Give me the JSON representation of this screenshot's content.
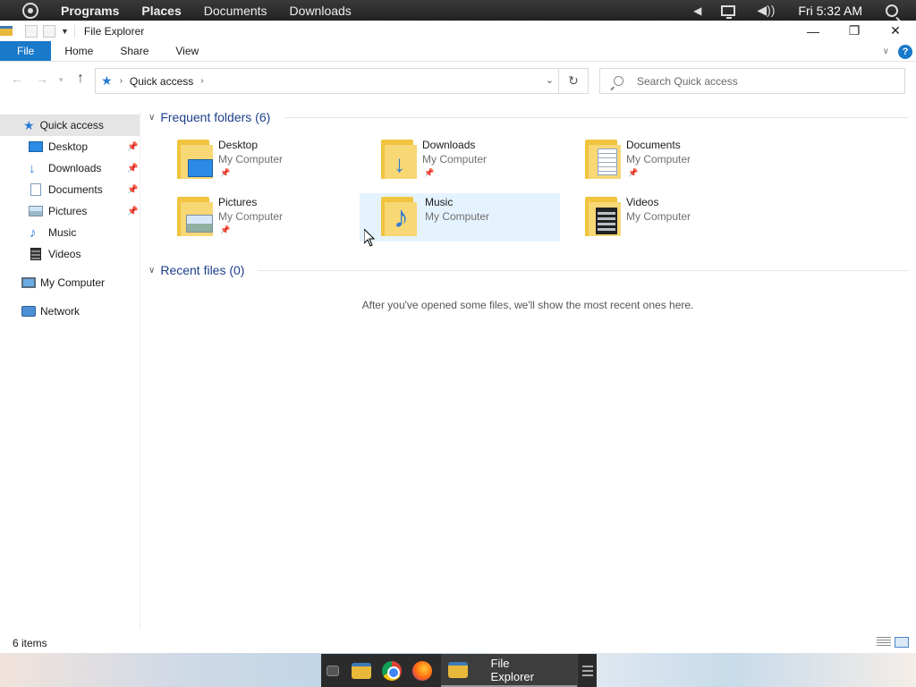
{
  "top_panel": {
    "menus": [
      "Programs",
      "Places",
      "Documents",
      "Downloads"
    ],
    "clock": "Fri 5:32 AM"
  },
  "window": {
    "title": "File Explorer"
  },
  "ribbon": {
    "tabs": [
      "File",
      "Home",
      "Share",
      "View"
    ],
    "help": "?"
  },
  "address": {
    "location": "Quick access",
    "search_placeholder": "Search Quick access"
  },
  "sidebar": {
    "items": [
      {
        "label": "Quick access",
        "icon": "star-icon",
        "pinned": false,
        "active": true
      },
      {
        "label": "Desktop",
        "icon": "desktop-icon",
        "pinned": true
      },
      {
        "label": "Downloads",
        "icon": "download-arrow-icon",
        "pinned": true
      },
      {
        "label": "Documents",
        "icon": "document-icon",
        "pinned": true
      },
      {
        "label": "Pictures",
        "icon": "picture-icon",
        "pinned": true
      },
      {
        "label": "Music",
        "icon": "music-note-icon",
        "pinned": false
      },
      {
        "label": "Videos",
        "icon": "film-icon",
        "pinned": false
      },
      {
        "label": "My Computer",
        "icon": "computer-icon",
        "pinned": false
      },
      {
        "label": "Network",
        "icon": "network-icon",
        "pinned": false
      }
    ]
  },
  "frequent": {
    "heading": "Frequent folders (6)",
    "folders": [
      {
        "name": "Desktop",
        "location": "My Computer",
        "pinned": true
      },
      {
        "name": "Downloads",
        "location": "My Computer",
        "pinned": true
      },
      {
        "name": "Documents",
        "location": "My Computer",
        "pinned": true
      },
      {
        "name": "Pictures",
        "location": "My Computer",
        "pinned": true
      },
      {
        "name": "Music",
        "location": "My Computer",
        "pinned": false
      },
      {
        "name": "Videos",
        "location": "My Computer",
        "pinned": false
      }
    ]
  },
  "recent": {
    "heading": "Recent files (0)",
    "empty_message": "After you've opened some files, we'll show the most recent ones here."
  },
  "status": {
    "item_count": "6 items"
  },
  "dock": {
    "active_label": "File Explorer"
  },
  "colors": {
    "accent": "#1979ca",
    "selection": "#e5f3ff",
    "folder": "#f0c43f"
  }
}
